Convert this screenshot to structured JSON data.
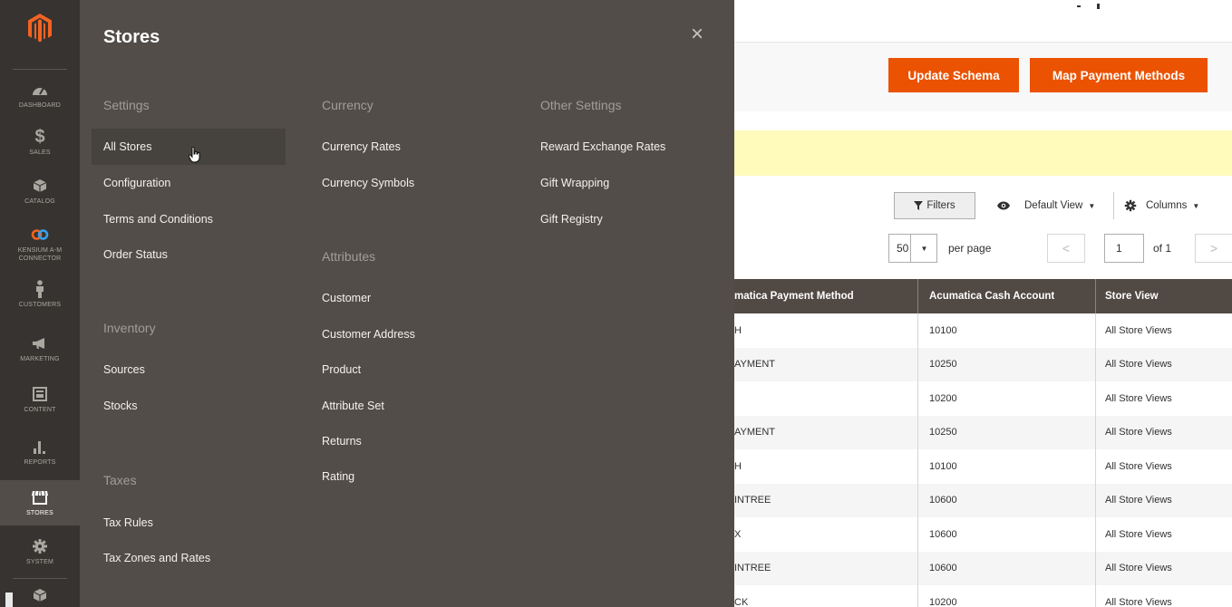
{
  "nav": {
    "items": [
      {
        "label": "DASHBOARD",
        "icon": "dashboard-icon"
      },
      {
        "label": "SALES",
        "icon": "dollar-icon"
      },
      {
        "label": "CATALOG",
        "icon": "box-icon"
      },
      {
        "label": "KENSIUM A-M CONNECTOR",
        "icon": "connector-icon"
      },
      {
        "label": "CUSTOMERS",
        "icon": "person-icon"
      },
      {
        "label": "MARKETING",
        "icon": "megaphone-icon"
      },
      {
        "label": "CONTENT",
        "icon": "content-icon"
      },
      {
        "label": "REPORTS",
        "icon": "bar-chart-icon"
      },
      {
        "label": "STORES",
        "icon": "store-icon"
      },
      {
        "label": "SYSTEM",
        "icon": "gear-icon"
      }
    ]
  },
  "flyout": {
    "title": "Stores",
    "close_glyph": "×",
    "settings": {
      "heading": "Settings",
      "links": [
        "All Stores",
        "Configuration",
        "Terms and Conditions",
        "Order Status"
      ]
    },
    "inventory": {
      "heading": "Inventory",
      "links": [
        "Sources",
        "Stocks"
      ]
    },
    "taxes": {
      "heading": "Taxes",
      "links": [
        "Tax Rules",
        "Tax Zones and Rates"
      ]
    },
    "currency": {
      "heading": "Currency",
      "links": [
        "Currency Rates",
        "Currency Symbols"
      ]
    },
    "attributes": {
      "heading": "Attributes",
      "links": [
        "Customer",
        "Customer Address",
        "Product",
        "Attribute Set",
        "Returns",
        "Rating"
      ]
    },
    "other": {
      "heading": "Other Settings",
      "links": [
        "Reward Exchange Rates",
        "Gift Wrapping",
        "Gift Registry"
      ]
    }
  },
  "page": {
    "update_schema": "Update Schema",
    "map_payment": "Map Payment Methods",
    "toolbar": {
      "filters": "Filters",
      "default_view": "Default View",
      "columns": "Columns",
      "per_page_value": "50",
      "per_page_label": "per page",
      "page_value": "1",
      "page_of": "of 1"
    },
    "table": {
      "headers": [
        "matica Payment Method",
        "Acumatica Cash Account",
        "Store View"
      ],
      "rows": [
        [
          "H",
          "10100",
          "All Store Views"
        ],
        [
          "AYMENT",
          "10250",
          "All Store Views"
        ],
        [
          "",
          "10200",
          "All Store Views"
        ],
        [
          "AYMENT",
          "10250",
          "All Store Views"
        ],
        [
          "H",
          "10100",
          "All Store Views"
        ],
        [
          "INTREE",
          "10600",
          "All Store Views"
        ],
        [
          "X",
          "10600",
          "All Store Views"
        ],
        [
          "INTREE",
          "10600",
          "All Store Views"
        ],
        [
          "CK",
          "10200",
          "All Store Views"
        ]
      ]
    }
  }
}
